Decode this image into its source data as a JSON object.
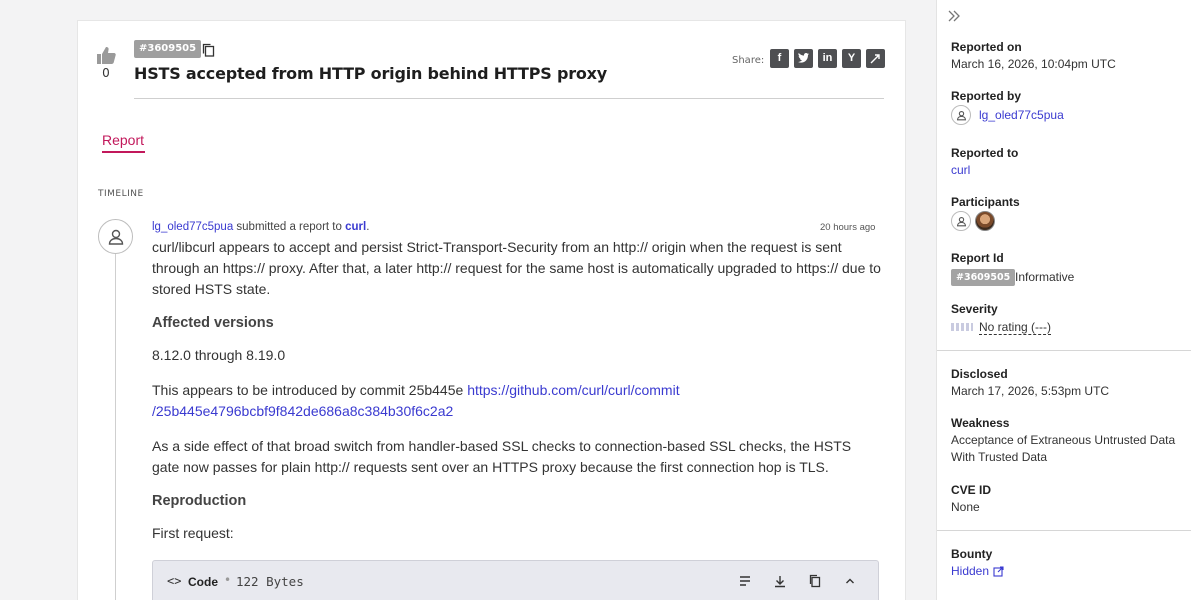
{
  "report": {
    "id_badge": "#3609505",
    "title": "HSTS accepted from HTTP origin behind HTTPS proxy",
    "votes": "0",
    "share_label": "Share:",
    "share_icons": [
      "facebook-icon",
      "twitter-icon",
      "linkedin-icon",
      "ycombinator-icon",
      "external-share-icon"
    ]
  },
  "tabs": {
    "report": "Report"
  },
  "timeline": {
    "label": "TIMELINE",
    "entry": {
      "author": "lg_oled77c5pua",
      "action": " submitted a report to ",
      "target": "curl",
      "period": ".",
      "time": "20 hours ago",
      "intro": "curl/libcurl appears to accept and persist Strict-Transport-Security from an http:// origin when the request is sent through an https:// proxy. After that, a later http:// request for the same host is automatically upgraded to https:// due to stored HSTS state.",
      "affected_heading": "Affected versions",
      "affected_text": "8.12.0 through 8.19.0",
      "commit_prefix": "This appears to be introduced by commit 25b445e ",
      "commit_link_line1": "https://github.com/curl/curl/commit",
      "commit_link_line2": "/25b445e4796bcbf9f842de686a8c384b30f6c2a2",
      "side_effect": "As a side effect of that broad switch from handler-based SSL checks to connection-based SSL checks, the HSTS gate now passes for plain http:// requests sent over an HTTPS proxy because the first connection hop is TLS.",
      "repro_heading": "Reproduction",
      "first_request": "First request:",
      "code_label": "Code",
      "code_size": "122 Bytes"
    }
  },
  "sidebar": {
    "reported_on_label": "Reported on",
    "reported_on": "March 16, 2026, 10:04pm UTC",
    "reported_by_label": "Reported by",
    "reported_by": "lg_oled77c5pua",
    "reported_to_label": "Reported to",
    "reported_to": "curl",
    "participants_label": "Participants",
    "report_id_label": "Report Id",
    "report_id": "#3609505",
    "report_status": "Informative",
    "severity_label": "Severity",
    "severity": "No rating (---)",
    "disclosed_label": "Disclosed",
    "disclosed": "March 17, 2026, 5:53pm UTC",
    "weakness_label": "Weakness",
    "weakness_line1": "Acceptance of Extraneous Untrusted Data",
    "weakness_line2": "With Trusted Data",
    "cve_label": "CVE ID",
    "cve": "None",
    "bounty_label": "Bounty",
    "bounty": "Hidden"
  },
  "colors": {
    "accent": "#c2185b",
    "link": "#3a3ad0",
    "badge": "#9f9f9f"
  }
}
